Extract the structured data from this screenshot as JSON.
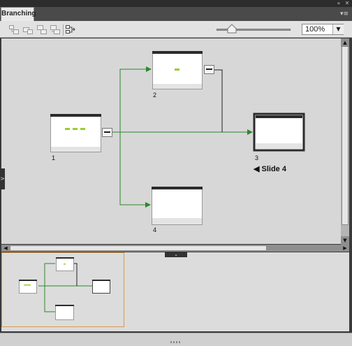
{
  "window": {
    "top_controls": [
      "«",
      "✕"
    ]
  },
  "panel": {
    "tab_label": "Branching",
    "menu_icon": "▾≡"
  },
  "toolbar": {
    "buttons": [
      "expand-slide-icon",
      "collapse-slide-icon",
      "expand-all-icon",
      "collapse-all-icon",
      "export-branching-icon"
    ],
    "zoom": {
      "value": "100%",
      "level_fraction": 0.21,
      "dropdown_icon": "▼"
    }
  },
  "slides": [
    {
      "number": "1",
      "buttons": 3
    },
    {
      "number": "2",
      "buttons": 1
    },
    {
      "number": "3",
      "selected": true,
      "name": "Slide 4"
    },
    {
      "number": "4",
      "buttons": 0
    }
  ],
  "slide3_title": "Slide 4",
  "colors": {
    "branch_line": "#2a8a2a",
    "overview_frame": "#d89a4a",
    "button_green": "#9acd32"
  },
  "scroll": {
    "up": "▲",
    "down": "▼",
    "left": "◀",
    "right": "▶"
  },
  "collapse_glyph": "⌄",
  "side_toggle_glyph": ">"
}
